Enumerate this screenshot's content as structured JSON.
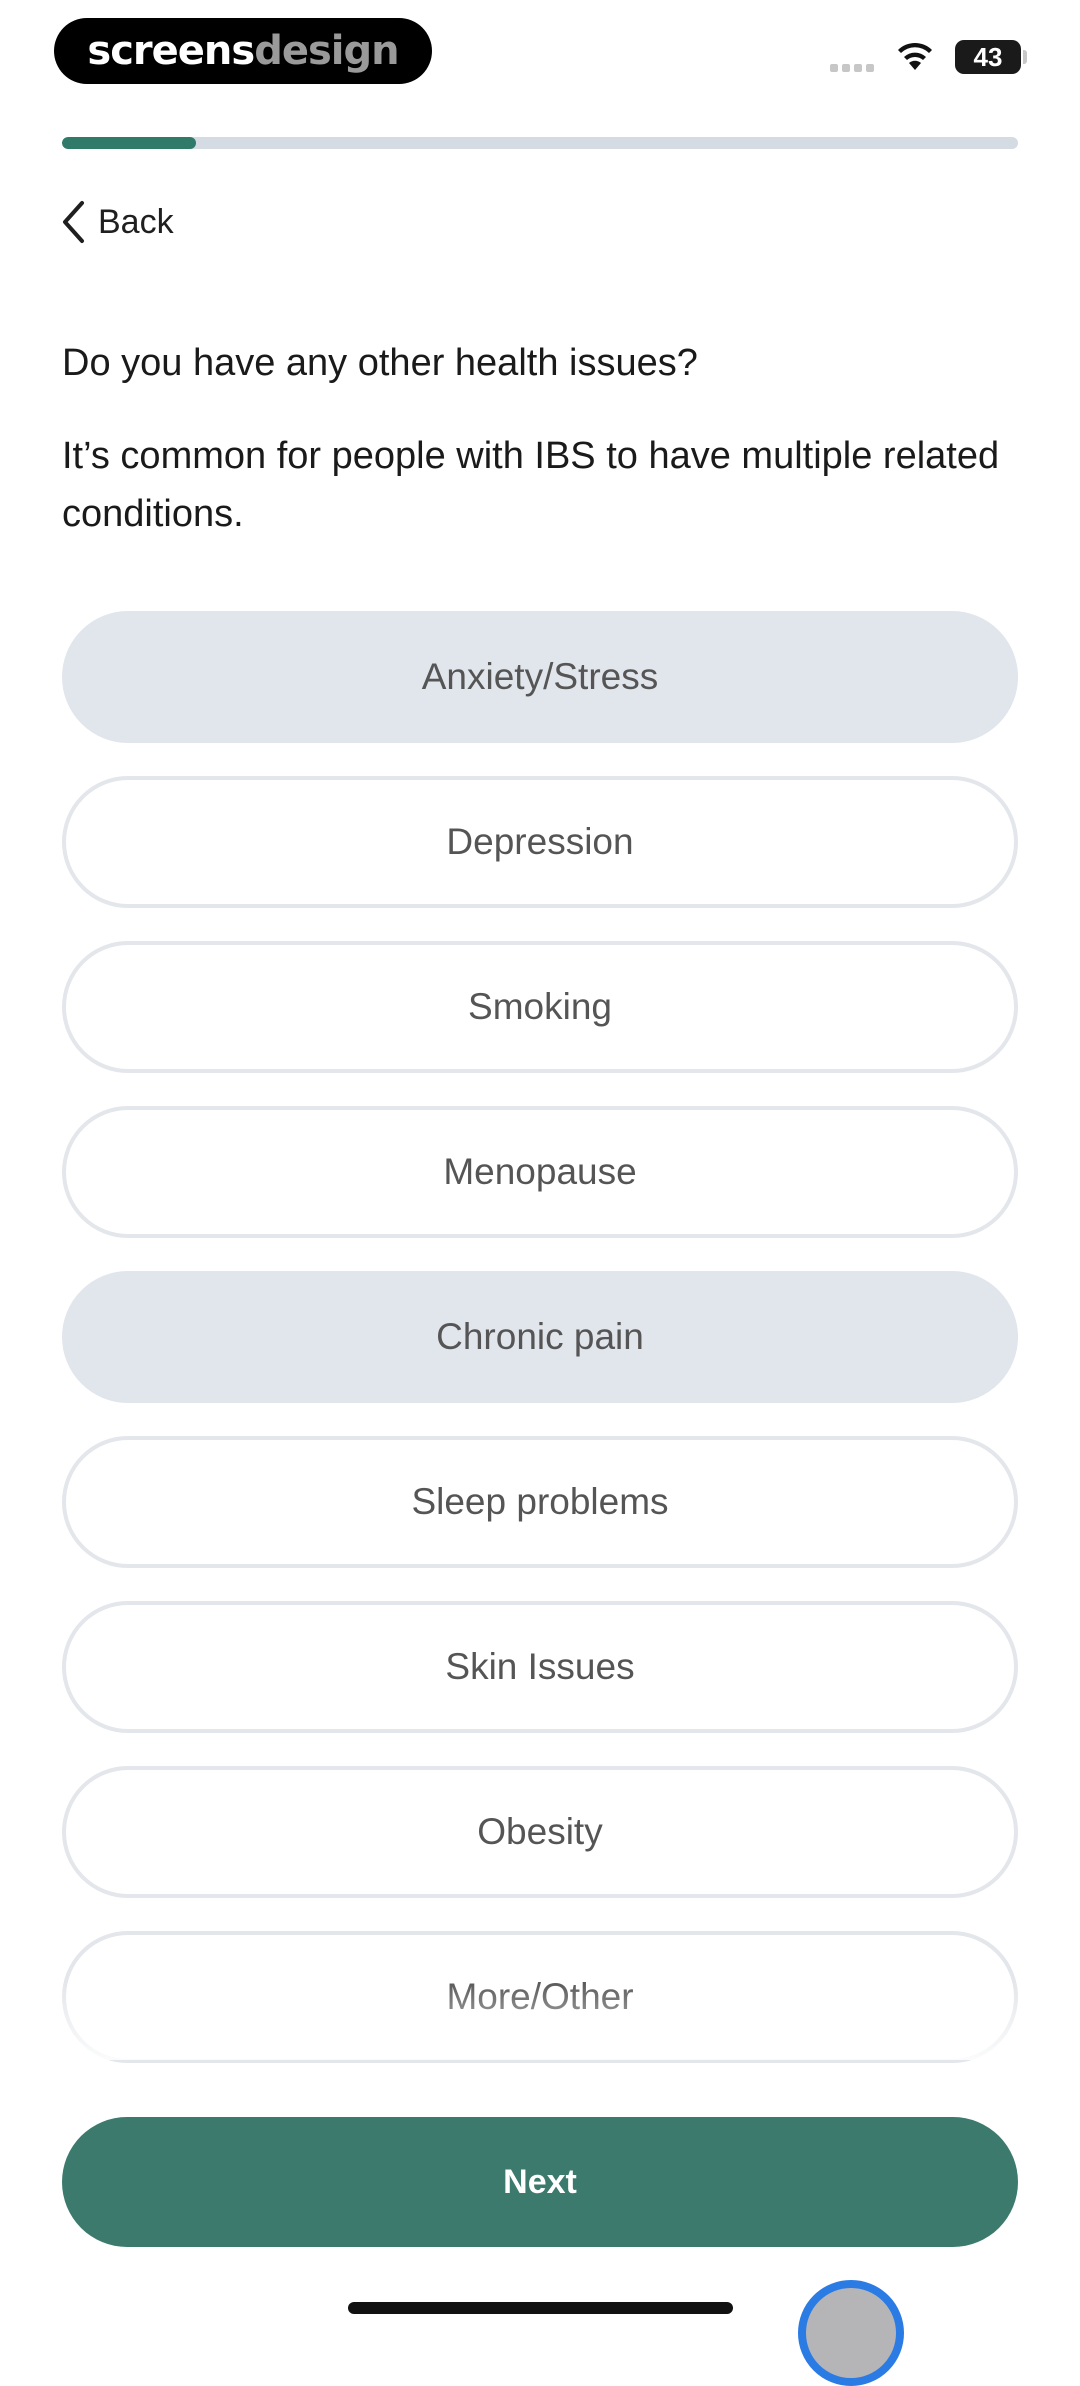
{
  "status_bar": {
    "brand_part1": "screens",
    "brand_part2": "design",
    "battery_level": "43",
    "wifi_icon": "wifi-icon",
    "signal_icon": "signal-dots-icon"
  },
  "progress": {
    "fraction": 0.14,
    "fill_color": "#2f7a69",
    "track_color": "#d5dbe3"
  },
  "nav": {
    "back_label": "Back",
    "back_icon": "chevron-left-icon"
  },
  "question": {
    "title": "Do you have any other health issues?",
    "subtitle": "It’s common for people with IBS to have multiple related conditions."
  },
  "options": [
    {
      "label": "Anxiety/Stress",
      "selected": true
    },
    {
      "label": "Depression",
      "selected": false
    },
    {
      "label": "Smoking",
      "selected": false
    },
    {
      "label": "Menopause",
      "selected": false
    },
    {
      "label": "Chronic pain",
      "selected": true
    },
    {
      "label": "Sleep problems",
      "selected": false
    },
    {
      "label": "Skin Issues",
      "selected": false
    },
    {
      "label": "Obesity",
      "selected": false
    },
    {
      "label": "More/Other",
      "selected": false
    }
  ],
  "footer": {
    "next_label": "Next",
    "accent_color": "#3b7a6c"
  }
}
